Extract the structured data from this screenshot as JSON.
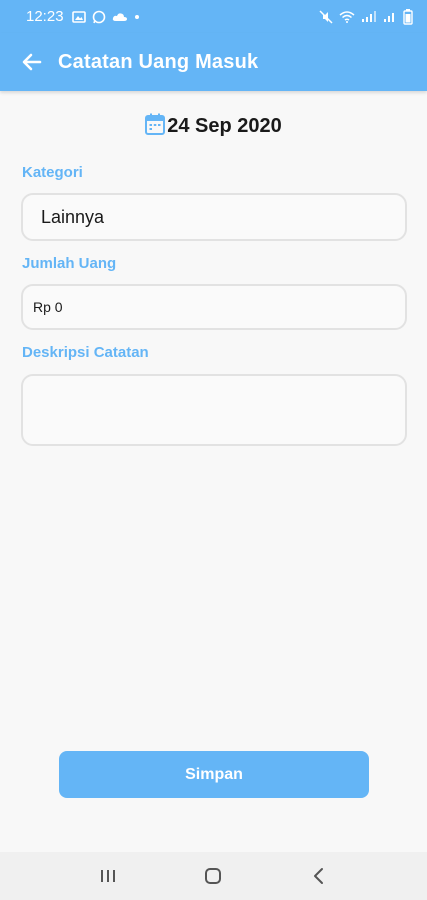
{
  "status_bar": {
    "time": "12:23",
    "left_icons": [
      "image-icon",
      "whatsapp-icon",
      "cloud-icon",
      "dot-icon"
    ],
    "right_icons": [
      "mute-icon",
      "wifi-icon",
      "signal-icon-1",
      "signal-icon-2",
      "battery-icon"
    ]
  },
  "app_bar": {
    "title": "Catatan Uang Masuk",
    "back_icon": "arrow-left-icon"
  },
  "date": {
    "icon": "calendar-icon",
    "value": "24 Sep 2020"
  },
  "form": {
    "kategori": {
      "label": "Kategori",
      "value": "Lainnya"
    },
    "jumlah": {
      "label": "Jumlah Uang",
      "value": "Rp 0"
    },
    "deskripsi": {
      "label": "Deskripsi Catatan",
      "value": ""
    }
  },
  "save_button": {
    "label": "Simpan"
  },
  "nav_bar": {
    "buttons": [
      "recent-apps-icon",
      "home-icon",
      "back-icon"
    ]
  },
  "colors": {
    "primary": "#64b5f6",
    "background": "#f8f8f8",
    "field_border": "#e2e2e2"
  }
}
